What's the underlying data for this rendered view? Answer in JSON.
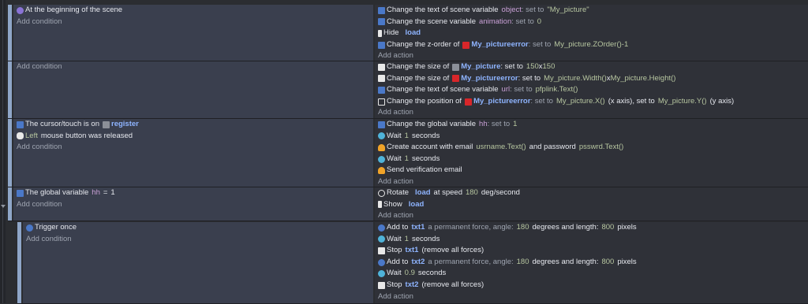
{
  "events": [
    {
      "conditions": [
        "At the beginning of the scene"
      ],
      "add_condition": "Add condition",
      "actions": [
        {
          "pre": "Change the text of scene variable",
          "var": "object",
          "mid": ": set to",
          "val": "\"My_picture\""
        },
        {
          "pre": "Change the scene variable",
          "var": "animation",
          "mid": ": set to",
          "val": "0"
        },
        {
          "pre": "Hide",
          "obj": "load"
        },
        {
          "pre": "Change the z-order of",
          "obj": "My_pictureerror",
          "mid": ": set to",
          "val": "My_picture.ZOrder()-1"
        }
      ],
      "add_action": "Add action"
    },
    {
      "add_condition": "Add condition",
      "actions": [
        {
          "pre": "Change the size of",
          "obj": "My_picture",
          "mid": ": set to",
          "val": "150",
          "x": "x",
          "val2": "150"
        },
        {
          "pre": "Change the size of",
          "obj": "My_pictureerror",
          "mid": ": set to",
          "val": "My_picture.Width()",
          "x": "x",
          "val2": "My_picture.Height()"
        },
        {
          "pre": "Change the text of scene variable",
          "var": "url",
          "mid": ": set to",
          "val": "pfplink.Text()"
        },
        {
          "pre": "Change the position of",
          "obj": "My_pictureerror",
          "mid": ": set to",
          "val": "My_picture.X()",
          "x": "(x axis), set to",
          "val2": "My_picture.Y()",
          "post": "(y axis)"
        }
      ],
      "add_action": "Add action"
    },
    {
      "conditions": [
        {
          "pre": "The cursor/touch is on",
          "obj": "register"
        },
        {
          "pre": "Left",
          "post": "mouse button was released"
        }
      ],
      "add_condition": "Add condition",
      "actions": [
        {
          "pre": "Change the global variable",
          "var": "hh",
          "mid": ": set to",
          "val": "1"
        },
        {
          "pre": "Wait",
          "val": "1",
          "post": "seconds"
        },
        {
          "pre": "Create account with email",
          "val": "usrname.Text()",
          "mid": "and password",
          "val2": "psswrd.Text()"
        },
        {
          "pre": "Wait",
          "val": "1",
          "post": "seconds"
        },
        {
          "pre": "Send verification email"
        }
      ],
      "add_action": "Add action"
    },
    {
      "conditions": [
        {
          "pre": "The global variable",
          "var": "hh",
          "mid": "=",
          "val": "1"
        }
      ],
      "add_condition": "Add condition",
      "actions": [
        {
          "pre": "Rotate",
          "obj": "load",
          "mid": "at speed",
          "val": "180",
          "post": "deg/second"
        },
        {
          "pre": "Show",
          "obj": "load"
        }
      ],
      "add_action": "Add action"
    },
    {
      "conditions": [
        "Trigger once"
      ],
      "add_condition": "Add condition",
      "actions": [
        {
          "pre": "Add to",
          "obj": "txt1",
          "mid": "a permanent force, angle:",
          "val": "180",
          "mid2": "degrees and length:",
          "val2": "800",
          "post": "pixels"
        },
        {
          "pre": "Wait",
          "val": "1",
          "post": "seconds"
        },
        {
          "pre": "Stop",
          "obj": "txt1",
          "post": "(remove all forces)"
        },
        {
          "pre": "Add to",
          "obj": "txt2",
          "mid": "a permanent force, angle:",
          "val": "180",
          "mid2": "degrees and length:",
          "val2": "800",
          "post": "pixels"
        },
        {
          "pre": "Wait",
          "val": "0.9",
          "post": "seconds"
        },
        {
          "pre": "Stop",
          "obj": "txt2",
          "post": "(remove all forces)"
        }
      ],
      "add_action": "Add action"
    }
  ]
}
